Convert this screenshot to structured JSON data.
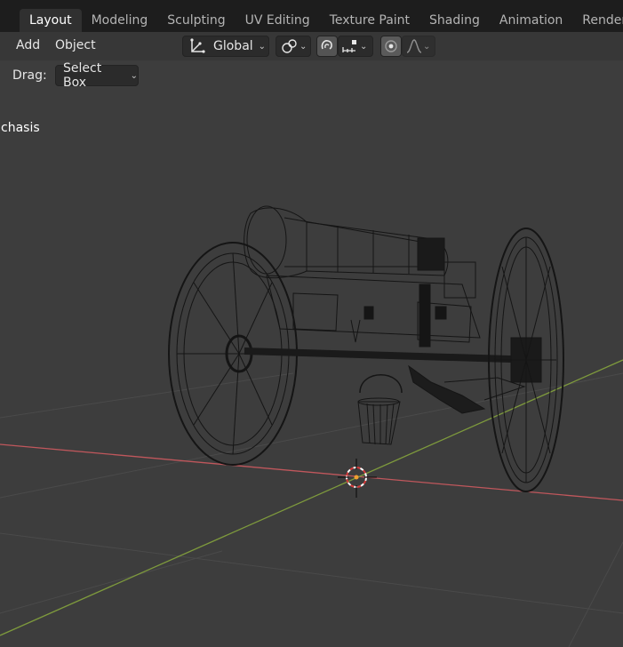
{
  "workspace_tabs": [
    {
      "label": "Layout",
      "active": true
    },
    {
      "label": "Modeling",
      "active": false
    },
    {
      "label": "Sculpting",
      "active": false
    },
    {
      "label": "UV Editing",
      "active": false
    },
    {
      "label": "Texture Paint",
      "active": false
    },
    {
      "label": "Shading",
      "active": false
    },
    {
      "label": "Animation",
      "active": false
    },
    {
      "label": "Rendering",
      "active": false
    }
  ],
  "header": {
    "menu": {
      "add": "Add",
      "object": "Object"
    },
    "transform_orientation": "Global",
    "pivot_icon": "link-circles-icon",
    "snap_icon": "magnet-icon",
    "snap_target_icon": "snap-increment-icon",
    "proportional_edit_icon": "proportional-circle-icon",
    "falloff_icon": "falloff-curve-icon"
  },
  "tool_settings": {
    "drag_label": "Drag:",
    "drag_value": "Select Box"
  },
  "viewport": {
    "object_name": "chasis",
    "colors": {
      "background": "#3d3d3d",
      "x_axis": "#c0575c",
      "y_axis": "#7e9a3d",
      "grid": "#4a4a4a",
      "wire": "#151515"
    }
  }
}
